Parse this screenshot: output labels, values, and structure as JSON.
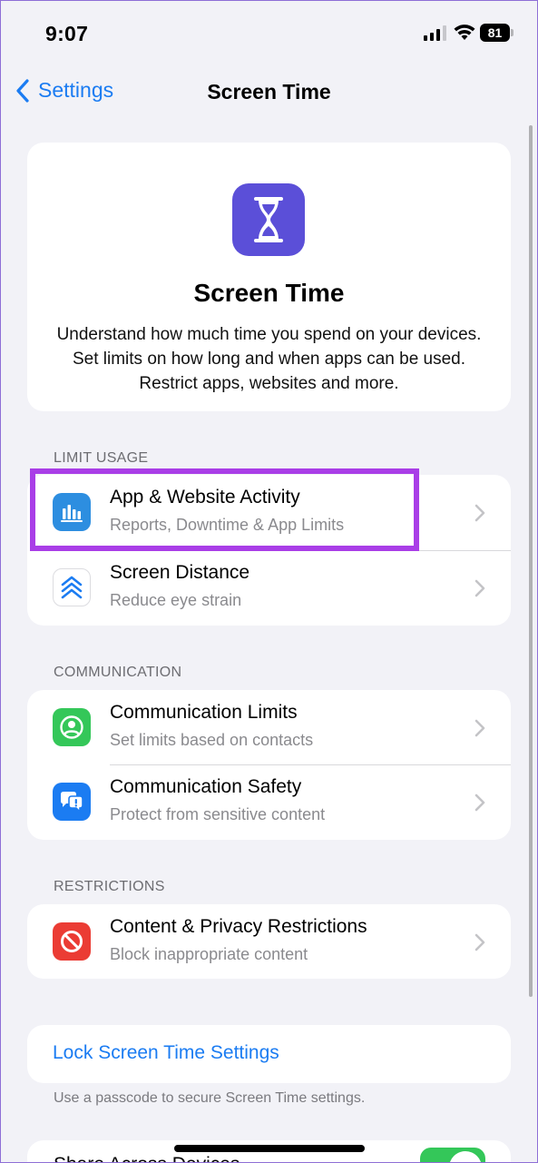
{
  "status_bar": {
    "time": "9:07",
    "battery": "81"
  },
  "nav": {
    "back_label": "Settings",
    "title": "Screen Time"
  },
  "header": {
    "title": "Screen Time",
    "description": "Understand how much time you spend on your devices. Set limits on how long and when apps can be used. Restrict apps, websites and more."
  },
  "sections": {
    "limit_usage": {
      "label": "LIMIT USAGE",
      "items": [
        {
          "title": "App & Website Activity",
          "subtitle": "Reports, Downtime & App Limits",
          "icon": "bar-chart-icon"
        },
        {
          "title": "Screen Distance",
          "subtitle": "Reduce eye strain",
          "icon": "chevrons-up-icon"
        }
      ]
    },
    "communication": {
      "label": "COMMUNICATION",
      "items": [
        {
          "title": "Communication Limits",
          "subtitle": "Set limits based on contacts",
          "icon": "contact-circle-icon"
        },
        {
          "title": "Communication Safety",
          "subtitle": "Protect from sensitive content",
          "icon": "chat-bubbles-icon"
        }
      ]
    },
    "restrictions": {
      "label": "RESTRICTIONS",
      "items": [
        {
          "title": "Content & Privacy Restrictions",
          "subtitle": "Block inappropriate content",
          "icon": "no-entry-icon"
        }
      ]
    }
  },
  "lock": {
    "link": "Lock Screen Time Settings",
    "footnote": "Use a passcode to secure Screen Time settings."
  },
  "partial_row": {
    "title": "Share Across Devices",
    "toggle_on": true
  },
  "colors": {
    "accent": "#1b7cf2",
    "hourglass_bg": "#5b4fd8",
    "activity_bg": "#2d8ee0",
    "limits_bg": "#34c759",
    "safety_bg": "#1b7cf2",
    "restrictions_bg": "#eb3c34",
    "highlight": "#a93ee7"
  }
}
